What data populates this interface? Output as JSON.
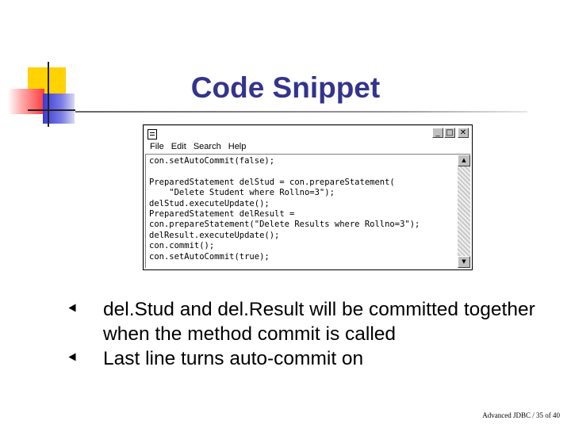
{
  "slide": {
    "title": "Code Snippet",
    "bullets": [
      "del.Stud and del.Result will be committed together when the method commit is called",
      "Last line turns auto-commit on"
    ],
    "footer": "Advanced JDBC / 35 of 40"
  },
  "window": {
    "menu": [
      {
        "label": "File",
        "icon": ""
      },
      {
        "label": "Edit",
        "icon": ""
      },
      {
        "label": "Search",
        "icon": ""
      },
      {
        "label": "Help",
        "icon": ""
      }
    ],
    "controls": {
      "minimize": "_",
      "maximize": "□",
      "close": "✕"
    },
    "code": "con.setAutoCommit(false);\n\nPreparedStatement delStud = con.prepareStatement(\n    \"Delete Student where Rollno=3\");\ndelStud.executeUpdate();\nPreparedStatement delResult =\ncon.prepareStatement(\"Delete Results where Rollno=3\");\ndelResult.executeUpdate();\ncon.commit();\ncon.setAutoCommit(true);"
  },
  "colors": {
    "title": "#34348c",
    "logo_yellow": "#ffd200",
    "logo_red": "#ff3a3a",
    "logo_blue": "#3a3ad6"
  },
  "icons": [
    "notepad-icon",
    "minimize-icon",
    "maximize-icon",
    "close-icon",
    "scroll-up-icon",
    "scroll-down-icon",
    "bullet-icon"
  ]
}
